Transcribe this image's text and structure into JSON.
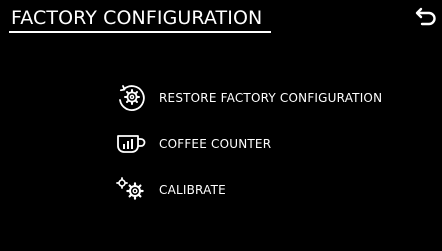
{
  "header": {
    "title": "FACTORY CONFIGURATION",
    "back_icon": "return-arrow-icon"
  },
  "menu": {
    "items": [
      {
        "label": "RESTORE FACTORY CONFIGURATION",
        "icon": "restore-gear-icon"
      },
      {
        "label": "COFFEE COUNTER",
        "icon": "coffee-cup-counter-icon"
      },
      {
        "label": "CALIBRATE",
        "icon": "gears-icon"
      }
    ]
  },
  "colors": {
    "background": "#000000",
    "foreground": "#ffffff"
  }
}
